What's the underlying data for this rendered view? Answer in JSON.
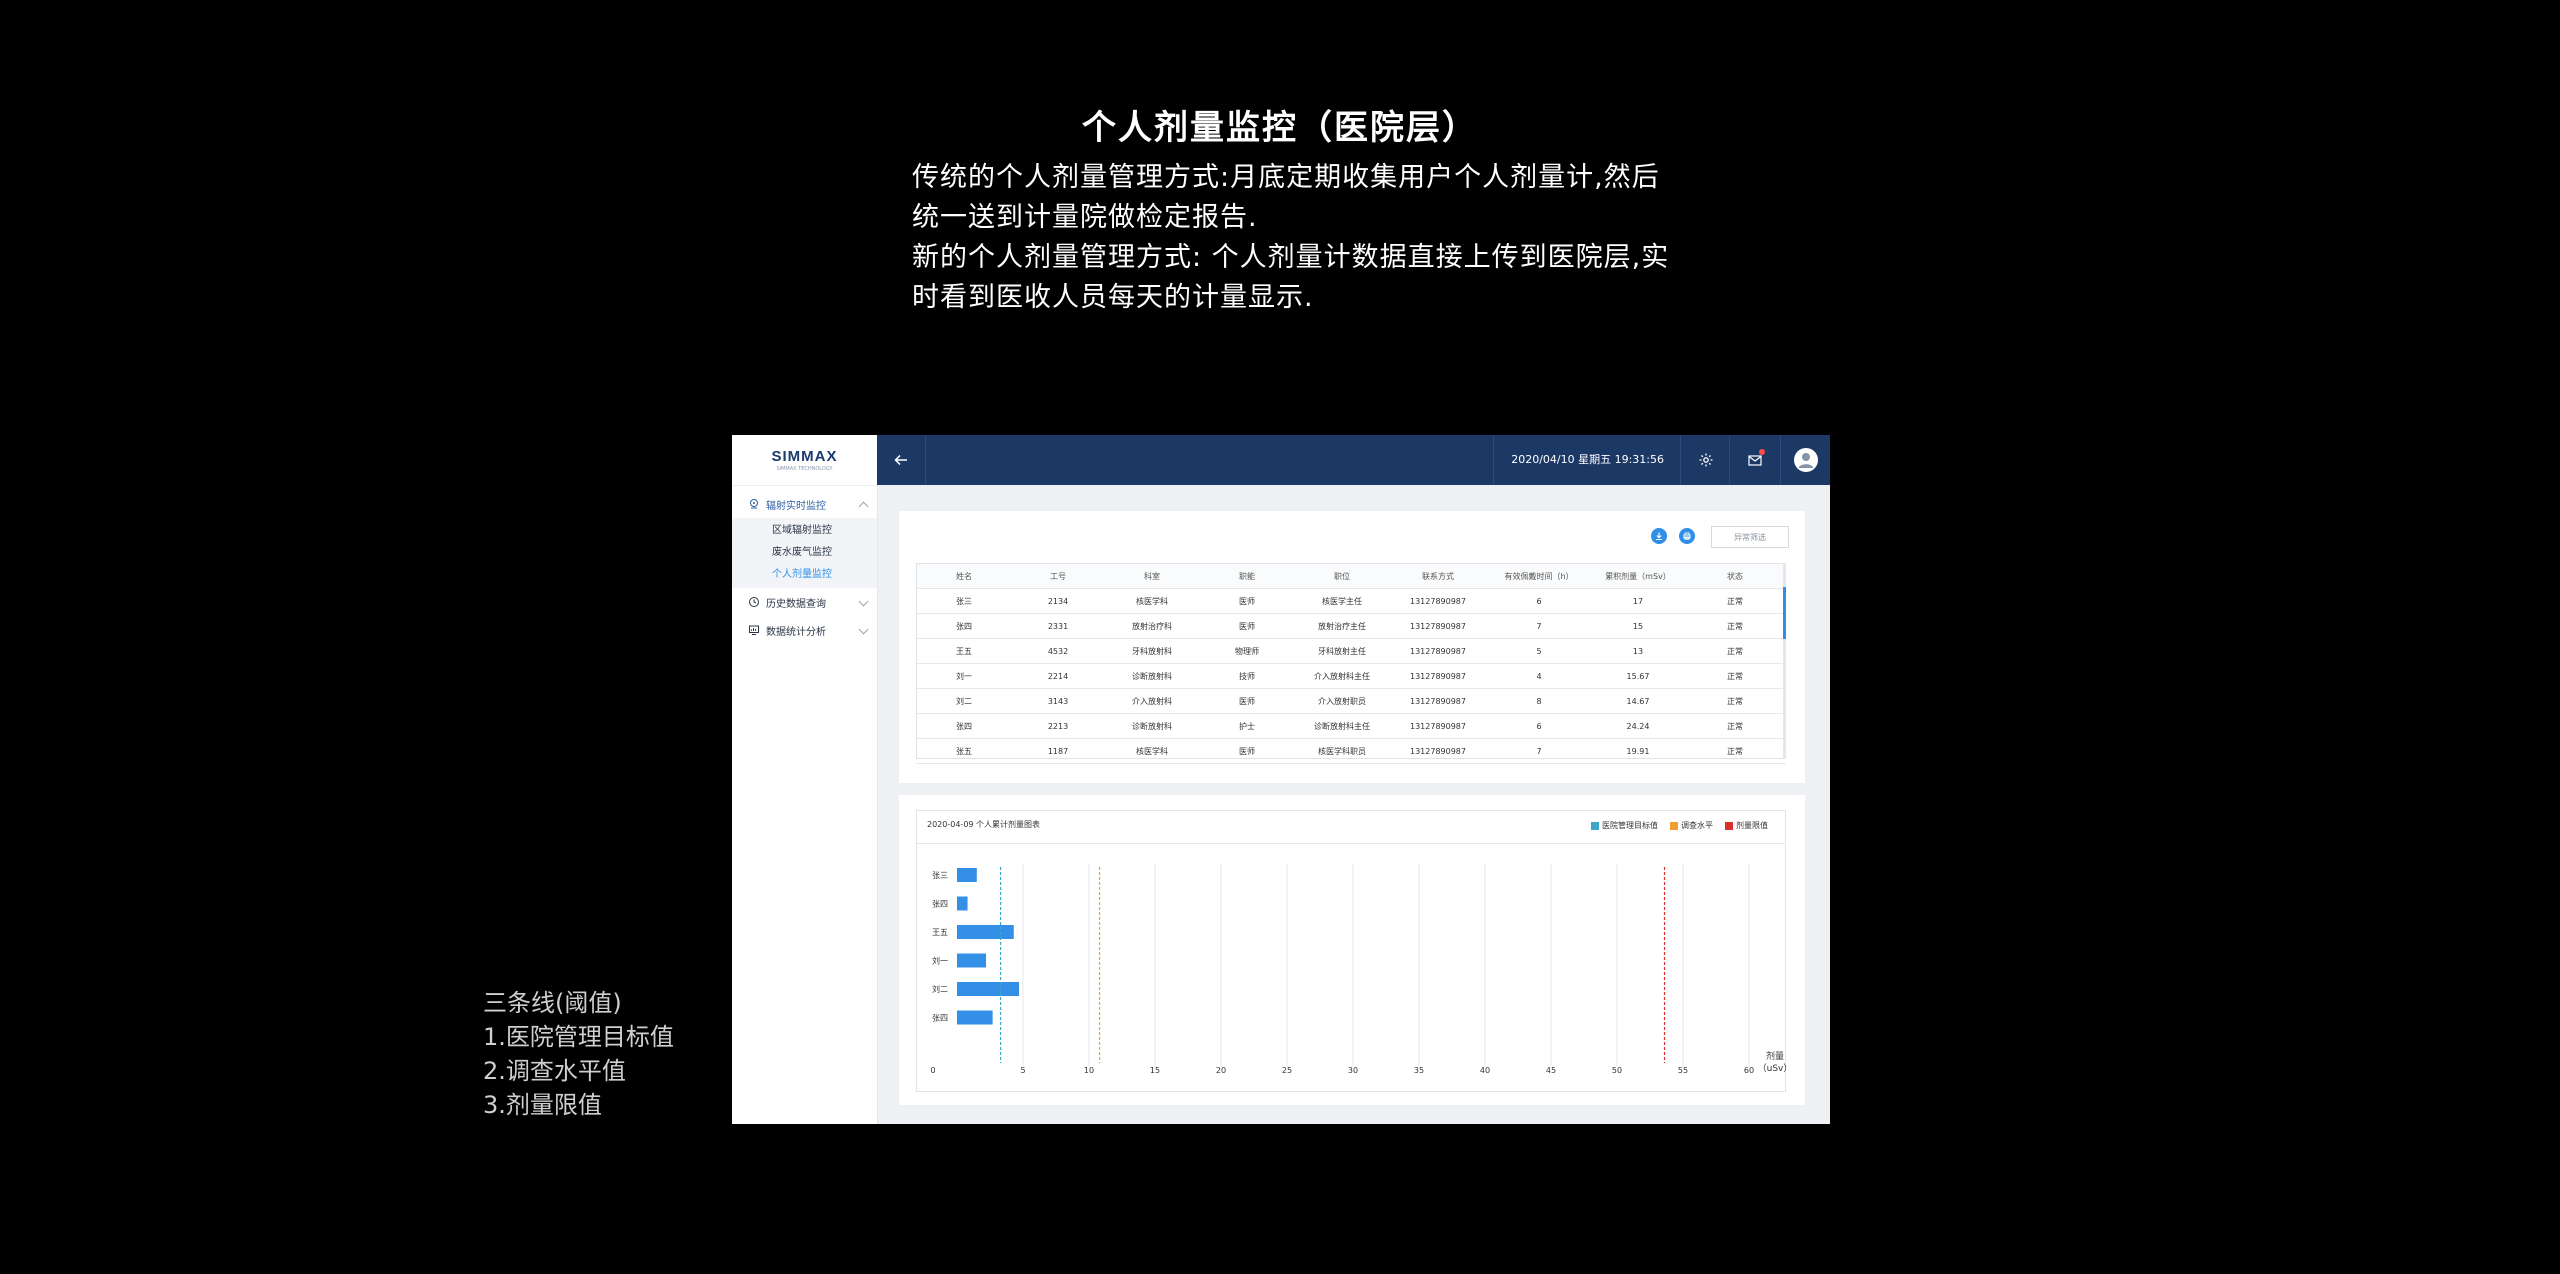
{
  "slide": {
    "title": "个人剂量监控（医院层）",
    "desc": [
      "传统的个人剂量管理方式:月底定期收集用户个人剂量计,然后统一送到计量院做检定报告.",
      "新的个人剂量管理方式: 个人剂量计数据直接上传到医院层,实时看到医收人员每天的计量显示."
    ],
    "note": [
      "三条线(阈值)",
      "1.医院管理目标值",
      "2.调查水平值",
      "3.剂量限值"
    ]
  },
  "sidebar": {
    "logo": "SIMMAX",
    "logo_sub": "SIMMAX TECHNOLOGY",
    "groups": [
      {
        "label": "辐射实时监控",
        "icon": "radiation-location-icon",
        "expanded": true
      },
      {
        "label": "历史数据查询",
        "icon": "history-clock-icon",
        "expanded": false
      },
      {
        "label": "数据统计分析",
        "icon": "statistics-monitor-icon",
        "expanded": false
      }
    ],
    "sub_items": [
      "区域辐射监控",
      "废水废气监控",
      "个人剂量监控"
    ]
  },
  "topbar": {
    "datetime": "2020/04/10 星期五   19:31:56"
  },
  "table_card": {
    "filter_label": "异常筛选",
    "columns": [
      "姓名",
      "工号",
      "科室",
      "职能",
      "职位",
      "联系方式",
      "有效佩戴时间（h）",
      "累积剂量（mSv）",
      "状态"
    ],
    "rows": [
      [
        "张三",
        "2134",
        "核医学科",
        "医师",
        "核医学主任",
        "13127890987",
        "6",
        "17",
        "正常"
      ],
      [
        "张四",
        "2331",
        "放射治疗科",
        "医师",
        "放射治疗主任",
        "13127890987",
        "7",
        "15",
        "正常"
      ],
      [
        "王五",
        "4532",
        "牙科放射科",
        "物理师",
        "牙科放射主任",
        "13127890987",
        "5",
        "13",
        "正常"
      ],
      [
        "刘一",
        "2214",
        "诊断放射科",
        "技师",
        "介入放射科主任",
        "13127890987",
        "4",
        "15.67",
        "正常"
      ],
      [
        "刘二",
        "3143",
        "介入放射科",
        "医师",
        "介入放射职员",
        "13127890987",
        "8",
        "14.67",
        "正常"
      ],
      [
        "张四",
        "2213",
        "诊断放射科",
        "护士",
        "诊断放射科主任",
        "13127890987",
        "6",
        "24.24",
        "正常"
      ],
      [
        "张五",
        "1187",
        "核医学科",
        "医师",
        "核医学科职员",
        "13127890987",
        "7",
        "19.91",
        "正常"
      ]
    ]
  },
  "chart_card": {
    "title": "2020-04-09 个人累计剂量图表",
    "legend": [
      {
        "label": "医院管理目标值",
        "color": "#3aa6c8"
      },
      {
        "label": "调查水平",
        "color": "#f0a030"
      },
      {
        "label": "剂量限值",
        "color": "#d93030"
      }
    ]
  },
  "chart_data": {
    "type": "bar",
    "orientation": "horizontal",
    "title": "2020-04-09 个人累计剂量图表",
    "categories": [
      "张三",
      "张四",
      "王五",
      "刘一",
      "刘二",
      "张四"
    ],
    "values": [
      1.5,
      0.8,
      4.3,
      2.2,
      4.7,
      2.7
    ],
    "xlabel": "剂量（uSv）",
    "xlim": [
      0,
      60
    ],
    "xticks": [
      0,
      5,
      10,
      15,
      20,
      25,
      30,
      35,
      40,
      45,
      50,
      55,
      60
    ],
    "bar_color": "#3390e6",
    "grid": true,
    "thresholds": [
      {
        "name": "医院管理目标值",
        "value": 3.3,
        "color": "#3aa6c8"
      },
      {
        "name": "调查水平",
        "value": 10.8,
        "color": "#f0a030"
      },
      {
        "name": "剂量限值",
        "value": 53.6,
        "color": "#d93030"
      }
    ]
  }
}
